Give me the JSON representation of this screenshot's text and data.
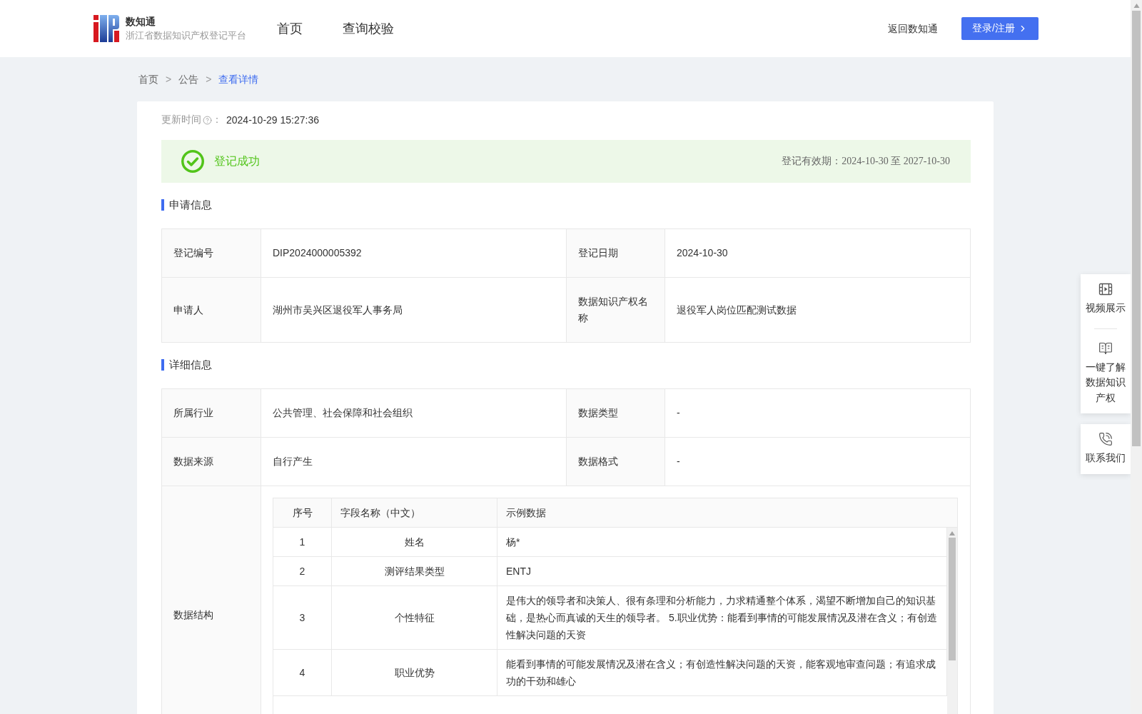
{
  "header": {
    "brand": {
      "title": "数知通",
      "subtitle": "浙江省数据知识产权登记平台"
    },
    "nav": [
      {
        "label": "首页"
      },
      {
        "label": "查询校验"
      }
    ],
    "back_link": "返回数知通",
    "login_button": "登录/注册"
  },
  "breadcrumb": {
    "items": [
      {
        "label": "首页",
        "selected": false
      },
      {
        "label": "公告",
        "selected": false
      },
      {
        "label": "查看详情",
        "selected": true
      }
    ],
    "separators": [
      ">",
      ">"
    ]
  },
  "update_time": {
    "label": "更新时间",
    "separator": "：",
    "value": "2024-10-29 15:27:36"
  },
  "status_banner": {
    "success": true,
    "label": "登记成功",
    "validity_label": "登记有效期：",
    "validity_value": "2024-10-30 至 2027-10-30"
  },
  "sections": [
    {
      "title": "申请信息",
      "rows": [
        {
          "kind": "pair",
          "cells": [
            {
              "label": "登记编号",
              "value": "DIP2024000005392"
            },
            {
              "label": "登记日期",
              "value": "2024-10-30"
            }
          ]
        },
        {
          "kind": "pair",
          "cells": [
            {
              "label": "申请人",
              "value": "湖州市吴兴区退役军人事务局"
            },
            {
              "label": "数据知识产权名称",
              "value": "退役军人岗位匹配测试数据"
            }
          ]
        }
      ]
    },
    {
      "title": "详细信息",
      "rows": [
        {
          "kind": "pair",
          "cells": [
            {
              "label": "所属行业",
              "value": "公共管理、社会保障和社会组织"
            },
            {
              "label": "数据类型",
              "value": "-"
            }
          ]
        },
        {
          "kind": "pair",
          "cells": [
            {
              "label": "数据来源",
              "value": "自行产生"
            },
            {
              "label": "数据格式",
              "value": "-"
            }
          ]
        },
        {
          "kind": "structure",
          "label": "数据结构",
          "columns": [
            "序号",
            "字段名称（中文）",
            "示例数据"
          ],
          "rows": [
            [
              "1",
              "姓名",
              "杨*"
            ],
            [
              "2",
              "测评结果类型",
              "ENTJ"
            ],
            [
              "3",
              "个性特征",
              "是伟大的领导者和决策人、很有条理和分析能力，力求精通整个体系，渴望不断增加自己的知识基础，是热心而真诚的天生的领导者。 5.职业优势：能看到事情的可能发展情况及潜在含义；有创造性解决问题的天资"
            ],
            [
              "4",
              "职业优势",
              "能看到事情的可能发展情况及潜在含义；有创造性解决问题的天资，能客观地审查问题；有追求成功的干劲和雄心"
            ]
          ]
        }
      ]
    }
  ],
  "side_panel": {
    "groups": [
      {
        "items": [
          {
            "kind": "video",
            "label": "视频展示"
          },
          {
            "kind": "guide",
            "label": "一键了解数据知识产权"
          }
        ]
      },
      {
        "items": [
          {
            "kind": "contact",
            "label": "联系我们"
          }
        ]
      }
    ]
  }
}
